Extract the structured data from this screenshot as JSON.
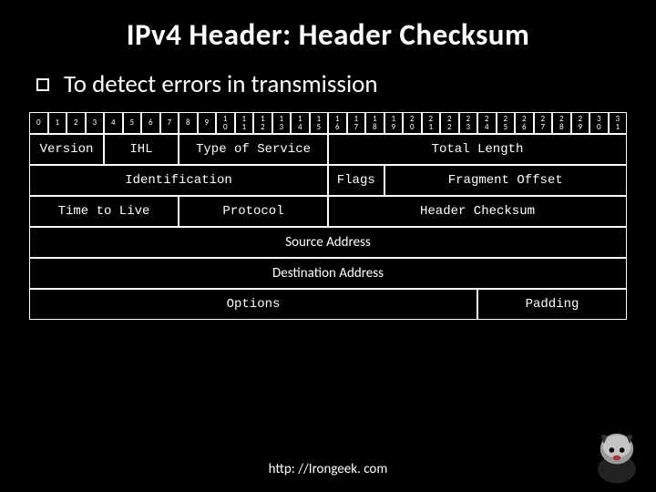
{
  "title": "IPv4 Header: Header Checksum",
  "bullet": "To detect errors in transmission",
  "bits": [
    "0",
    "1",
    "2",
    "3",
    "4",
    "5",
    "6",
    "7",
    "8",
    "9",
    "1 0",
    "1 1",
    "1 2",
    "1 3",
    "1 4",
    "1 5",
    "1 6",
    "1 7",
    "1 8",
    "1 9",
    "2 0",
    "2 1",
    "2 2",
    "2 3",
    "2 4",
    "2 5",
    "2 6",
    "2 7",
    "2 8",
    "2 9",
    "3 0",
    "3 1"
  ],
  "fields": {
    "version": "Version",
    "ihl": "IHL",
    "tos": "Type of Service",
    "total_length": "Total Length",
    "identification": "Identification",
    "flags": "Flags",
    "fragment_offset": "Fragment Offset",
    "ttl": "Time to Live",
    "protocol": "Protocol",
    "checksum": "Header Checksum",
    "src": "Source Address",
    "dst": "Destination Address",
    "options": "Options",
    "padding": "Padding"
  },
  "footer": "http: //Irongeek. com"
}
